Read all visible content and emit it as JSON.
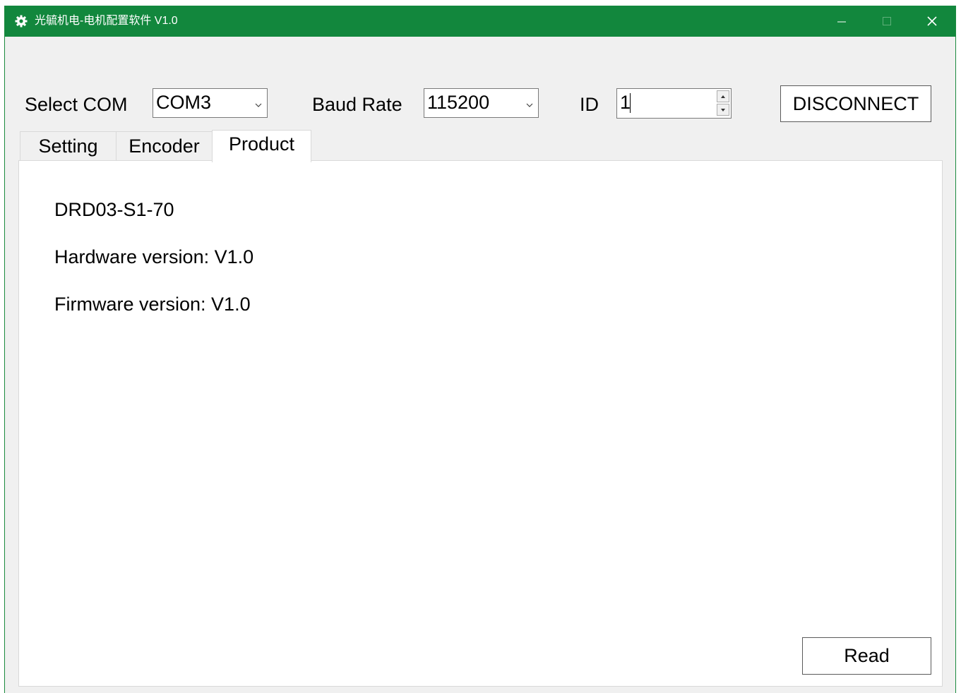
{
  "window": {
    "title": "光毓机电-电机配置软件 V1.0",
    "accent_color": "#12873d",
    "icon": "gear-icon"
  },
  "toolbar": {
    "com_label": "Select COM",
    "com_value": "COM3",
    "baud_label": "Baud Rate",
    "baud_value": "115200",
    "id_label": "ID",
    "id_value": "1",
    "connect_button": "DISCONNECT"
  },
  "tabs": [
    {
      "label": "Setting",
      "active": false
    },
    {
      "label": "Encoder",
      "active": false
    },
    {
      "label": "Product",
      "active": true
    }
  ],
  "product": {
    "model": "DRD03-S1-70",
    "hardware_version": "Hardware version: V1.0",
    "firmware_version": "Firmware version: V1.0",
    "read_button": "Read"
  }
}
